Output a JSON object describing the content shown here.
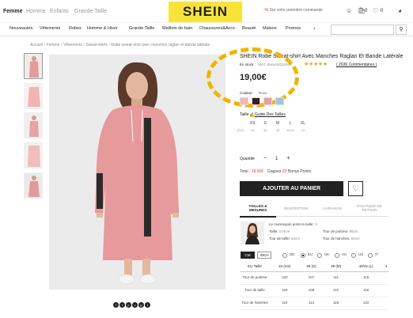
{
  "header": {
    "genders": [
      "Femme",
      "Homme",
      "Enfants",
      "Grande Taille"
    ],
    "logo": "SHEIN",
    "promo": "Sur votre première commande",
    "promo_mark": "-%",
    "bag_count": "0",
    "wish_count": "0"
  },
  "nav": {
    "items": [
      "Nouveautés",
      "Vêtements",
      "Robes",
      "Homme & Hiver",
      "Grande Taille",
      "Maillots de bain",
      "Chaussures&Accs",
      "Beauté",
      "Maison",
      "Promos"
    ],
    "more_arrow": "›",
    "search_placeholder": ""
  },
  "breadcrumb": "Accueil › Femme › Vêtements › Sweat-shirts › Robe sweat-shirt avec manches raglan et bande latérale",
  "product": {
    "title": "SHEIN Robe Sweat-shirt Avec Manches Raglan Et Bande Latérale",
    "stock": "En stock",
    "sku": "SKU: dress18112300",
    "stars": "★★★★★",
    "rating_value": 4.5,
    "reviews": "( 2636 Commentaires )",
    "price": "19,00€",
    "couleur_label": "Couleur:",
    "couleur_value": "Rose",
    "swatch_colors": [
      "#f2b9b9",
      "#3a1d20",
      "#e8a0a0",
      "#9bc6e9"
    ],
    "taille_label": "Taille",
    "guide_label": "Guide Des Tailles",
    "sizes": [
      "XS",
      "S",
      "M",
      "L",
      "XL"
    ],
    "size_sub": [
      "34",
      "36",
      "38",
      "40/42",
      "44"
    ],
    "size_sub_prefix": "(EU)",
    "quantity_label": "Quantité",
    "quantity_minus": "−",
    "quantity": "1",
    "quantity_plus": "+",
    "total_label": "Total :",
    "total_value": "19,00€",
    "gagnez_label": "Gagnez",
    "gagnez_value": "20",
    "gagnez_suffix": "Bonus Points",
    "add_to_cart": "AJOUTER AU PANIER",
    "wish_icon": "♡",
    "social": [
      "f",
      "t",
      "p",
      "v",
      "g",
      "t"
    ]
  },
  "tabs": [
    {
      "label": "TAILLES & MESURES"
    },
    {
      "label": "DESCRIPTION"
    },
    {
      "label": "LIVRAISON"
    },
    {
      "label": "POLITIQUE DE RETOUR"
    }
  ],
  "model": {
    "title": "Le mannequin porte la taille:",
    "title_value": "S",
    "taille_label": "Taille:",
    "taille_value": "174cm",
    "poitrine_label": "Tour de poitrine:",
    "poitrine_value": "80cm",
    "taille2_label": "Tour de taille:",
    "taille2_value": "64cm",
    "hanches_label": "Tour de hanches:",
    "hanches_value": "92cm"
  },
  "units": {
    "cm": "CM",
    "inch": "INCH",
    "regions": [
      "DE",
      "EU",
      "UK",
      "AU",
      "US",
      "IT"
    ],
    "selected_region": "EU"
  },
  "size_table": {
    "headers": [
      "EU Taille",
      "34 (XS)",
      "36 (S)",
      "38 (M)",
      "40/42 (L)",
      "4"
    ],
    "rows": [
      {
        "label": "Tour de poitrine",
        "values": [
          "103",
          "107",
          "111",
          "115"
        ]
      },
      {
        "label": "Tour de taille",
        "values": [
          "104",
          "108",
          "112",
          "116"
        ]
      },
      {
        "label": "Tour de hanches",
        "values": [
          "110",
          "114",
          "118",
          "122"
        ]
      }
    ]
  }
}
